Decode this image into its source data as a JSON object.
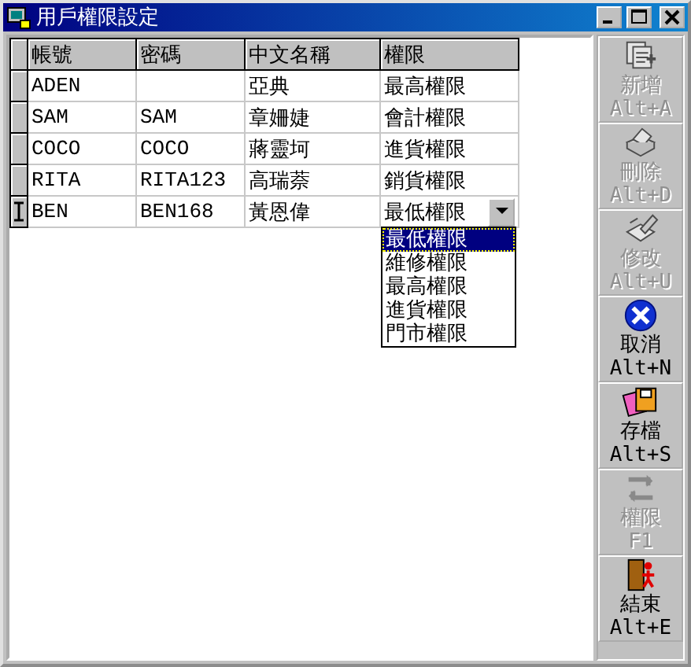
{
  "window": {
    "title": "用戶權限設定"
  },
  "table": {
    "columns": [
      "帳號",
      "密碼",
      "中文名稱",
      "權限"
    ],
    "rows": [
      {
        "cells": [
          "ADEN",
          "",
          "亞典",
          "最高權限"
        ],
        "current": false
      },
      {
        "cells": [
          "SAM",
          "SAM",
          "章姍婕",
          "會計權限"
        ],
        "current": false
      },
      {
        "cells": [
          "COCO",
          "COCO",
          "蔣靈坷",
          "進貨權限"
        ],
        "current": false
      },
      {
        "cells": [
          "RITA",
          "RITA123",
          "高瑞萘",
          "銷貨權限"
        ],
        "current": false
      },
      {
        "cells": [
          "BEN",
          "BEN168",
          "黃恩偉",
          "最低權限"
        ],
        "current": true
      }
    ]
  },
  "dropdown": {
    "options": [
      {
        "label": "最低權限",
        "selected": true
      },
      {
        "label": "維修權限",
        "selected": false
      },
      {
        "label": "最高權限",
        "selected": false
      },
      {
        "label": "進貨權限",
        "selected": false
      },
      {
        "label": "門市權限",
        "selected": false
      }
    ]
  },
  "toolbar": [
    {
      "kind": "add",
      "label": "新增",
      "shortcut": "Alt+A",
      "disabled": true
    },
    {
      "kind": "delete",
      "label": "刪除",
      "shortcut": "Alt+D",
      "disabled": true
    },
    {
      "kind": "edit",
      "label": "修改",
      "shortcut": "Alt+U",
      "disabled": true
    },
    {
      "kind": "cancel",
      "label": "取消",
      "shortcut": "Alt+N",
      "disabled": false
    },
    {
      "kind": "save",
      "label": "存檔",
      "shortcut": "Alt+S",
      "disabled": false
    },
    {
      "kind": "permission",
      "label": "權限",
      "shortcut": "F1",
      "disabled": true
    },
    {
      "kind": "exit",
      "label": "結束",
      "shortcut": "Alt+E",
      "disabled": false
    }
  ]
}
